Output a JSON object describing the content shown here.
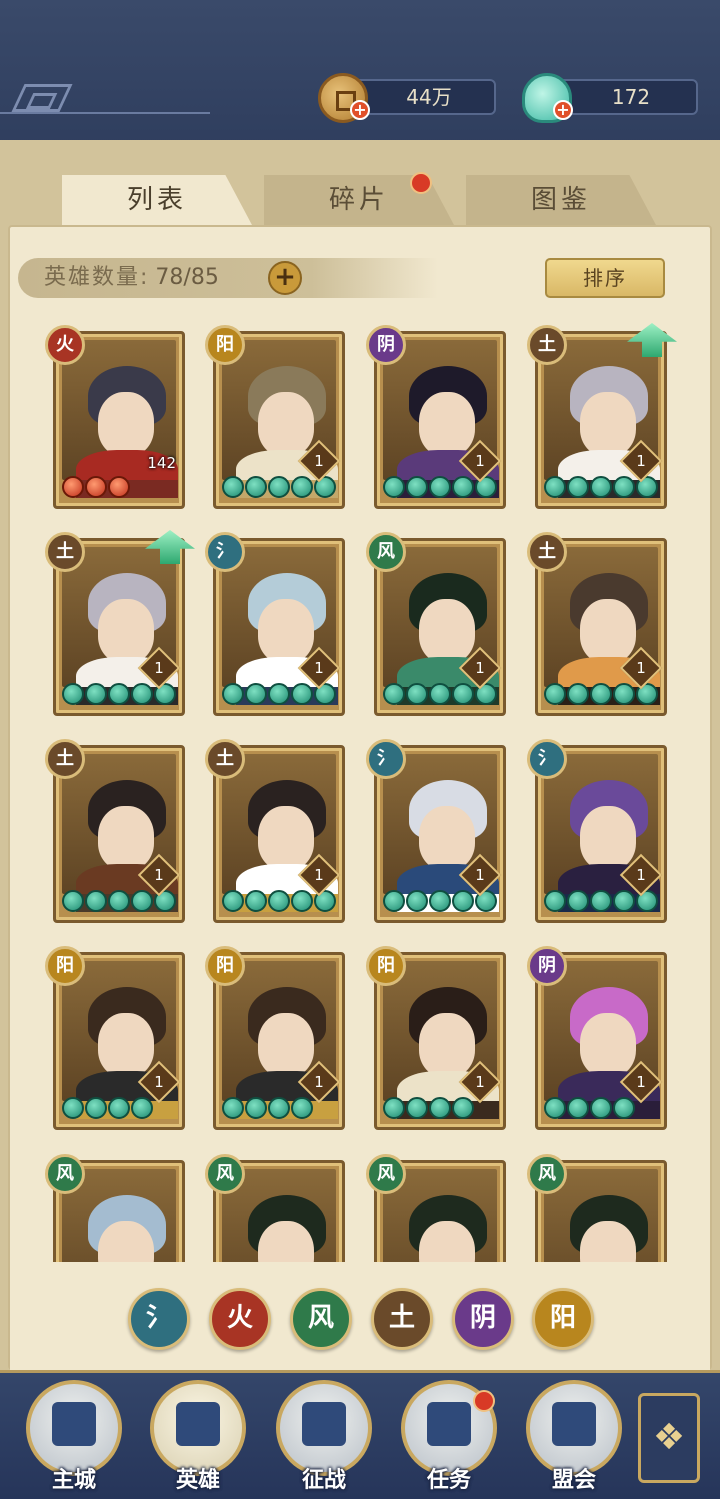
{
  "resources": {
    "coins": "44万",
    "jade": "172"
  },
  "tabs": [
    {
      "label": "列表",
      "active": true
    },
    {
      "label": "碎片",
      "active": false,
      "badge": true
    },
    {
      "label": "图鉴",
      "active": false
    }
  ],
  "hero_count": {
    "label": "英雄数量:",
    "value": "78/85"
  },
  "sort_label": "排序",
  "elements": {
    "water": {
      "glyph": "氵",
      "color": "#2f6f7f"
    },
    "fire": {
      "glyph": "火",
      "color": "#a83424"
    },
    "wind": {
      "glyph": "风",
      "color": "#2f7a4a"
    },
    "earth": {
      "glyph": "土",
      "color": "#6a4a2a"
    },
    "yin": {
      "glyph": "阴",
      "color": "#6a3a8a"
    },
    "yang": {
      "glyph": "阳",
      "color": "#b8861e"
    }
  },
  "heroes": [
    {
      "element": "fire",
      "stars": 3,
      "star_color": "red",
      "level": "142",
      "upgrade": false,
      "palette": [
        "#3a3a4a",
        "#a82a22",
        "#7a2a22"
      ]
    },
    {
      "element": "yang",
      "stars": 5,
      "star_color": "green",
      "level": "1",
      "upgrade": false,
      "palette": [
        "#8a7a5a",
        "#ece2c8",
        "#c4a86a"
      ]
    },
    {
      "element": "yin",
      "stars": 5,
      "star_color": "green",
      "level": "1",
      "upgrade": false,
      "palette": [
        "#1e1a2a",
        "#5a3a7a",
        "#2a1e3a"
      ]
    },
    {
      "element": "earth",
      "stars": 5,
      "star_color": "green",
      "level": "1",
      "upgrade": true,
      "palette": [
        "#b8b4c0",
        "#f4f0ea",
        "#2a2a2a"
      ]
    },
    {
      "element": "earth",
      "stars": 5,
      "star_color": "green",
      "level": "1",
      "upgrade": true,
      "palette": [
        "#b8b4c0",
        "#f4f0ea",
        "#2a2a2a"
      ]
    },
    {
      "element": "water",
      "stars": 5,
      "star_color": "green",
      "level": "1",
      "upgrade": false,
      "palette": [
        "#b4ccd8",
        "#ffffff",
        "#2a3a5a"
      ]
    },
    {
      "element": "wind",
      "stars": 5,
      "star_color": "green",
      "level": "1",
      "upgrade": false,
      "palette": [
        "#1a2a1e",
        "#3a8a6a",
        "#1e3a2a"
      ]
    },
    {
      "element": "earth",
      "stars": 5,
      "star_color": "green",
      "level": "1",
      "upgrade": false,
      "palette": [
        "#4a3a2e",
        "#e09a4a",
        "#2a2018"
      ]
    },
    {
      "element": "earth",
      "stars": 5,
      "star_color": "green",
      "level": "1",
      "upgrade": false,
      "palette": [
        "#2a2220",
        "#6a3a22",
        "#4a3a2a"
      ]
    },
    {
      "element": "earth",
      "stars": 5,
      "star_color": "green",
      "level": "1",
      "upgrade": false,
      "palette": [
        "#2a2220",
        "#ffffff",
        "#c8a040"
      ]
    },
    {
      "element": "water",
      "stars": 5,
      "star_color": "green",
      "level": "1",
      "upgrade": false,
      "palette": [
        "#d8dce4",
        "#2a4a7a",
        "#ffffff"
      ]
    },
    {
      "element": "water",
      "stars": 5,
      "star_color": "green",
      "level": "1",
      "upgrade": false,
      "palette": [
        "#6a4a9a",
        "#2a2040",
        "#1a2a4a"
      ]
    },
    {
      "element": "yang",
      "stars": 4,
      "star_color": "green",
      "level": "1",
      "upgrade": false,
      "palette": [
        "#3a2a1e",
        "#2a2a2a",
        "#c8a040"
      ]
    },
    {
      "element": "yang",
      "stars": 4,
      "star_color": "green",
      "level": "1",
      "upgrade": false,
      "palette": [
        "#3a2a1e",
        "#2a2a2a",
        "#c8a040"
      ]
    },
    {
      "element": "yang",
      "stars": 4,
      "star_color": "green",
      "level": "1",
      "upgrade": false,
      "palette": [
        "#2a1e18",
        "#ece2c8",
        "#3a2a1e"
      ]
    },
    {
      "element": "yin",
      "stars": 4,
      "star_color": "green",
      "level": "1",
      "upgrade": false,
      "palette": [
        "#c86ac8",
        "#3a2a5a",
        "#2a1e3a"
      ]
    },
    {
      "element": "wind",
      "stars": 0,
      "star_color": "green",
      "level": "",
      "upgrade": false,
      "palette": [
        "#a4bcd0",
        "#5a7a3a",
        "#3a5a2a"
      ]
    },
    {
      "element": "wind",
      "stars": 0,
      "star_color": "green",
      "level": "",
      "upgrade": false,
      "palette": [
        "#1e2a1e",
        "#3a4a3a",
        "#2a3a2a"
      ]
    },
    {
      "element": "wind",
      "stars": 0,
      "star_color": "green",
      "level": "",
      "upgrade": false,
      "palette": [
        "#1e2a1e",
        "#3a4a3a",
        "#2a3a2a"
      ]
    },
    {
      "element": "wind",
      "stars": 0,
      "star_color": "green",
      "level": "",
      "upgrade": false,
      "palette": [
        "#1e2a1e",
        "#3a4a3a",
        "#2a3a2a"
      ]
    }
  ],
  "filters": [
    "water",
    "fire",
    "wind",
    "earth",
    "yin",
    "yang"
  ],
  "nav": [
    {
      "label": "主城",
      "active": false,
      "badge": false,
      "icon": "palace-icon"
    },
    {
      "label": "英雄",
      "active": true,
      "badge": false,
      "icon": "hero-icon"
    },
    {
      "label": "征战",
      "active": false,
      "badge": false,
      "icon": "campaign-icon"
    },
    {
      "label": "任务",
      "active": false,
      "badge": true,
      "icon": "quest-icon"
    },
    {
      "label": "盟会",
      "active": false,
      "badge": false,
      "icon": "guild-icon"
    }
  ],
  "menu_icon": "menu-icon"
}
